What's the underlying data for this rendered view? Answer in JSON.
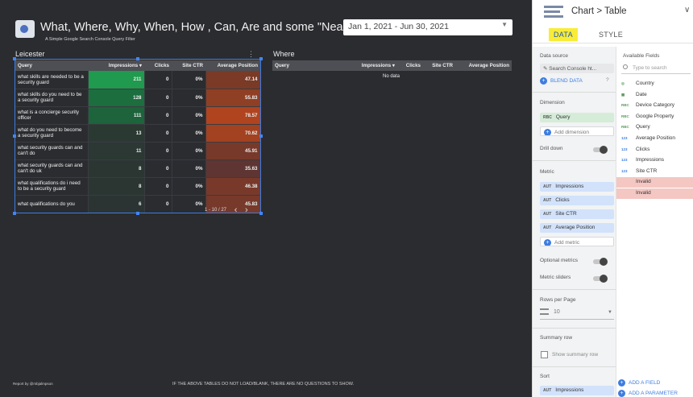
{
  "report": {
    "title": "What, Where, Why, When, How , Can, Are and some \"Near Me\"",
    "subtitle": "A Simple Google Search Console Query Filter",
    "date_range": "Jan 1, 2021 - Jun 30, 2021",
    "footer_credit": "Report by @mbjalmpson",
    "footer_note": "IF THE ABOVE TABLES DO NOT LOAD/BLANK, THERE ARE NO QUESTIONS TO SHOW."
  },
  "table_left": {
    "title": "Leicester",
    "headers": [
      "Query",
      "Impressions ▾",
      "Clicks",
      "Site CTR",
      "Average Position"
    ],
    "rows": [
      {
        "query": "what skills are needed to be a security guard",
        "impressions": "211",
        "clicks": "0",
        "ctr": "0%",
        "position": "47.14",
        "imp_color": "#1f9a4e",
        "pos_color": "#7a3a26"
      },
      {
        "query": "what skills do you need to be a security guard",
        "impressions": "128",
        "clicks": "0",
        "ctr": "0%",
        "position": "55.83",
        "imp_color": "#1c6e3f",
        "pos_color": "#8f3f24"
      },
      {
        "query": "what is a concierge security officer",
        "impressions": "111",
        "clicks": "0",
        "ctr": "0%",
        "position": "78.57",
        "imp_color": "#1d633b",
        "pos_color": "#b0441f"
      },
      {
        "query": "what do you need to become a security guard",
        "impressions": "13",
        "clicks": "0",
        "ctr": "0%",
        "position": "70.62",
        "imp_color": "#2b3933",
        "pos_color": "#a34221"
      },
      {
        "query": "what security guards can and can't do",
        "impressions": "11",
        "clicks": "0",
        "ctr": "0%",
        "position": "45.91",
        "imp_color": "#2b3833",
        "pos_color": "#77392a"
      },
      {
        "query": "what security guards can and can't do uk",
        "impressions": "8",
        "clicks": "0",
        "ctr": "0%",
        "position": "35.63",
        "imp_color": "#2b3633",
        "pos_color": "#5e3532"
      },
      {
        "query": "what qualifications do i need to be a security guard",
        "impressions": "8",
        "clicks": "0",
        "ctr": "0%",
        "position": "46.38",
        "imp_color": "#2b3633",
        "pos_color": "#79392a"
      },
      {
        "query": "what qualifications do you",
        "impressions": "6",
        "clicks": "0",
        "ctr": "0%",
        "position": "45.83",
        "imp_color": "#2b3433",
        "pos_color": "#77392a"
      }
    ],
    "pagination": "1 - 10 / 27",
    "prev_icon": "‹",
    "next_icon": "›"
  },
  "table_right": {
    "title": "Where",
    "headers": [
      "Query",
      "Impressions ▾",
      "Clicks",
      "Site CTR",
      "Average Position"
    ],
    "empty_text": "No data"
  },
  "panel": {
    "crumb_chart": "Chart",
    "crumb_sep": ">",
    "crumb_type": "Table",
    "collapse_icon": "∨",
    "tab_data": "DATA",
    "tab_style": "STYLE",
    "data_source_label": "Data source",
    "data_source_value": "Search Console ht...",
    "blend_data": "BLEND DATA",
    "dimension_label": "Dimension",
    "dimension_value": "Query",
    "add_dimension": "Add dimension",
    "drill_down": "Drill down",
    "metric_label": "Metric",
    "metrics": [
      "Impressions",
      "Clicks",
      "Site CTR",
      "Average Position"
    ],
    "add_metric": "Add metric",
    "optional_metrics": "Optional metrics",
    "metric_sliders": "Metric sliders",
    "rows_per_page_label": "Rows per Page",
    "rows_per_page_value": "10",
    "summary_row_label": "Summary row",
    "show_summary_row": "Show summary row",
    "sort_label": "Sort",
    "sort_value": "Impressions",
    "dim_tag": "RBC",
    "metric_tag": "AUT",
    "available_fields_label": "Available Fields",
    "search_placeholder": "Type to search",
    "fields": [
      {
        "name": "Country",
        "type": "geo"
      },
      {
        "name": "Date",
        "type": "date"
      },
      {
        "name": "Device Category",
        "type": "RBC"
      },
      {
        "name": "Google Property",
        "type": "RBC"
      },
      {
        "name": "Query",
        "type": "RBC"
      },
      {
        "name": "Average Position",
        "type": "123"
      },
      {
        "name": "Clicks",
        "type": "123"
      },
      {
        "name": "Impressions",
        "type": "123"
      },
      {
        "name": "Site CTR",
        "type": "123"
      },
      {
        "name": "Invalid",
        "type": ""
      },
      {
        "name": "Invalid",
        "type": ""
      }
    ],
    "add_field": "ADD A FIELD",
    "add_parameter": "ADD A PARAMETER"
  }
}
